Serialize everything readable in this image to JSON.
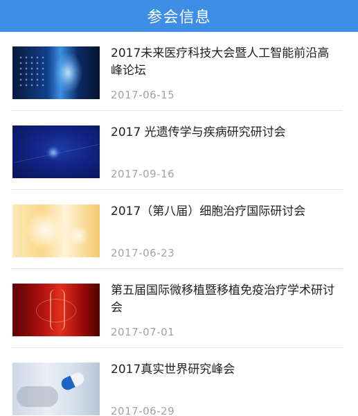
{
  "header": {
    "title": "参会信息"
  },
  "items": [
    {
      "title": "2017未来医疗科技大会暨人工智能前沿高峰论坛",
      "date": "2017-06-15",
      "thumb_icon": "tech-medical-image"
    },
    {
      "title": "2017 光遗传学与疾病研究研讨会",
      "date": "2017-09-16",
      "thumb_icon": "neuron-image"
    },
    {
      "title": "2017（第八届）细胞治疗国际研讨会",
      "date": "2017-06-23",
      "thumb_icon": "cell-image"
    },
    {
      "title": "第五届国际微移植暨移植免疫治疗学术研讨会",
      "date": "2017-07-01",
      "thumb_icon": "dna-image"
    },
    {
      "title": "2017真实世界研究峰会",
      "date": "2017-06-29",
      "thumb_icon": "pill-image"
    }
  ],
  "colors": {
    "header_bg": "#3f8ee6",
    "title_text": "#222222",
    "date_text": "#a3a3a3"
  }
}
